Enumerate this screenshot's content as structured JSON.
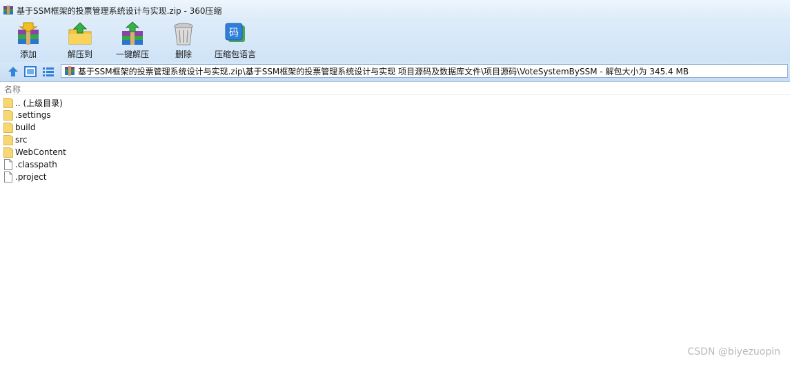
{
  "window": {
    "title": "基于SSM框架的投票管理系统设计与实现.zip - 360压缩"
  },
  "toolbar": {
    "buttons": [
      {
        "label": "添加",
        "icon": "add-archive-icon"
      },
      {
        "label": "解压到",
        "icon": "extract-to-icon"
      },
      {
        "label": "一键解压",
        "icon": "one-click-extract-icon"
      },
      {
        "label": "删除",
        "icon": "delete-trash-icon"
      },
      {
        "label": "压缩包语言",
        "icon": "archive-language-icon"
      }
    ],
    "language_icon_glyph": "码"
  },
  "address_bar": {
    "path": "基于SSM框架的投票管理系统设计与实现.zip\\基于SSM框架的投票管理系统设计与实现  项目源码及数据库文件\\项目源码\\VoteSystemBySSM - 解包大小为 345.4 MB"
  },
  "list": {
    "column_name": "名称",
    "items": [
      {
        "name": ".. (上级目录)",
        "type": "folder"
      },
      {
        "name": ".settings",
        "type": "folder"
      },
      {
        "name": "build",
        "type": "folder"
      },
      {
        "name": "src",
        "type": "folder"
      },
      {
        "name": "WebContent",
        "type": "folder"
      },
      {
        "name": ".classpath",
        "type": "file"
      },
      {
        "name": ".project",
        "type": "file"
      }
    ]
  },
  "watermark": "CSDN @biyezuopin",
  "colors": {
    "toolbar_bg": "#d6e8f9",
    "folder": "#f7d774",
    "accent_blue": "#2f7fd8"
  }
}
